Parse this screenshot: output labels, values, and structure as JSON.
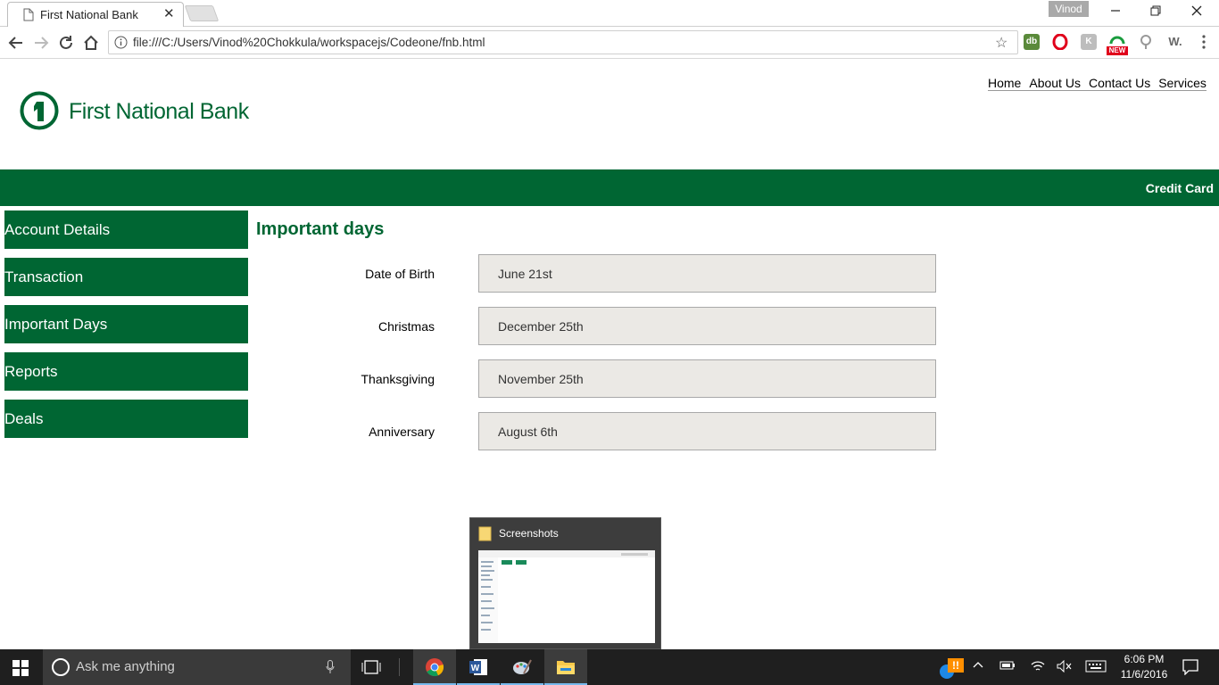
{
  "browser": {
    "tab_title": "First National Bank",
    "tab_close": "✕",
    "user_name": "Vinod",
    "url": "file:///C:/Users/Vinod%20Chokkula/workspacejs/Codeone/fnb.html",
    "ext_new_badge": "NEW",
    "ext_w_label": "W."
  },
  "site": {
    "logo_text": "First National Bank",
    "nav": [
      "Home",
      "About Us",
      "Contact Us",
      "Services"
    ],
    "banner_link": "Credit Card"
  },
  "sidebar": {
    "items": [
      "Account Details",
      "Transaction",
      "Important Days",
      "Reports",
      "Deals"
    ]
  },
  "main": {
    "title": "Important days",
    "rows": [
      {
        "label": "Date of Birth",
        "value": "June 21st"
      },
      {
        "label": "Christmas",
        "value": "December 25th"
      },
      {
        "label": "Thanksgiving",
        "value": "November 25th"
      },
      {
        "label": "Anniversary",
        "value": "August 6th"
      }
    ]
  },
  "thumbnail": {
    "title": "Screenshots"
  },
  "taskbar": {
    "search_placeholder": "Ask me anything",
    "time": "6:06 PM",
    "date": "11/6/2016"
  },
  "colors": {
    "brand_green": "#006633",
    "input_bg": "#ebe9e5"
  }
}
